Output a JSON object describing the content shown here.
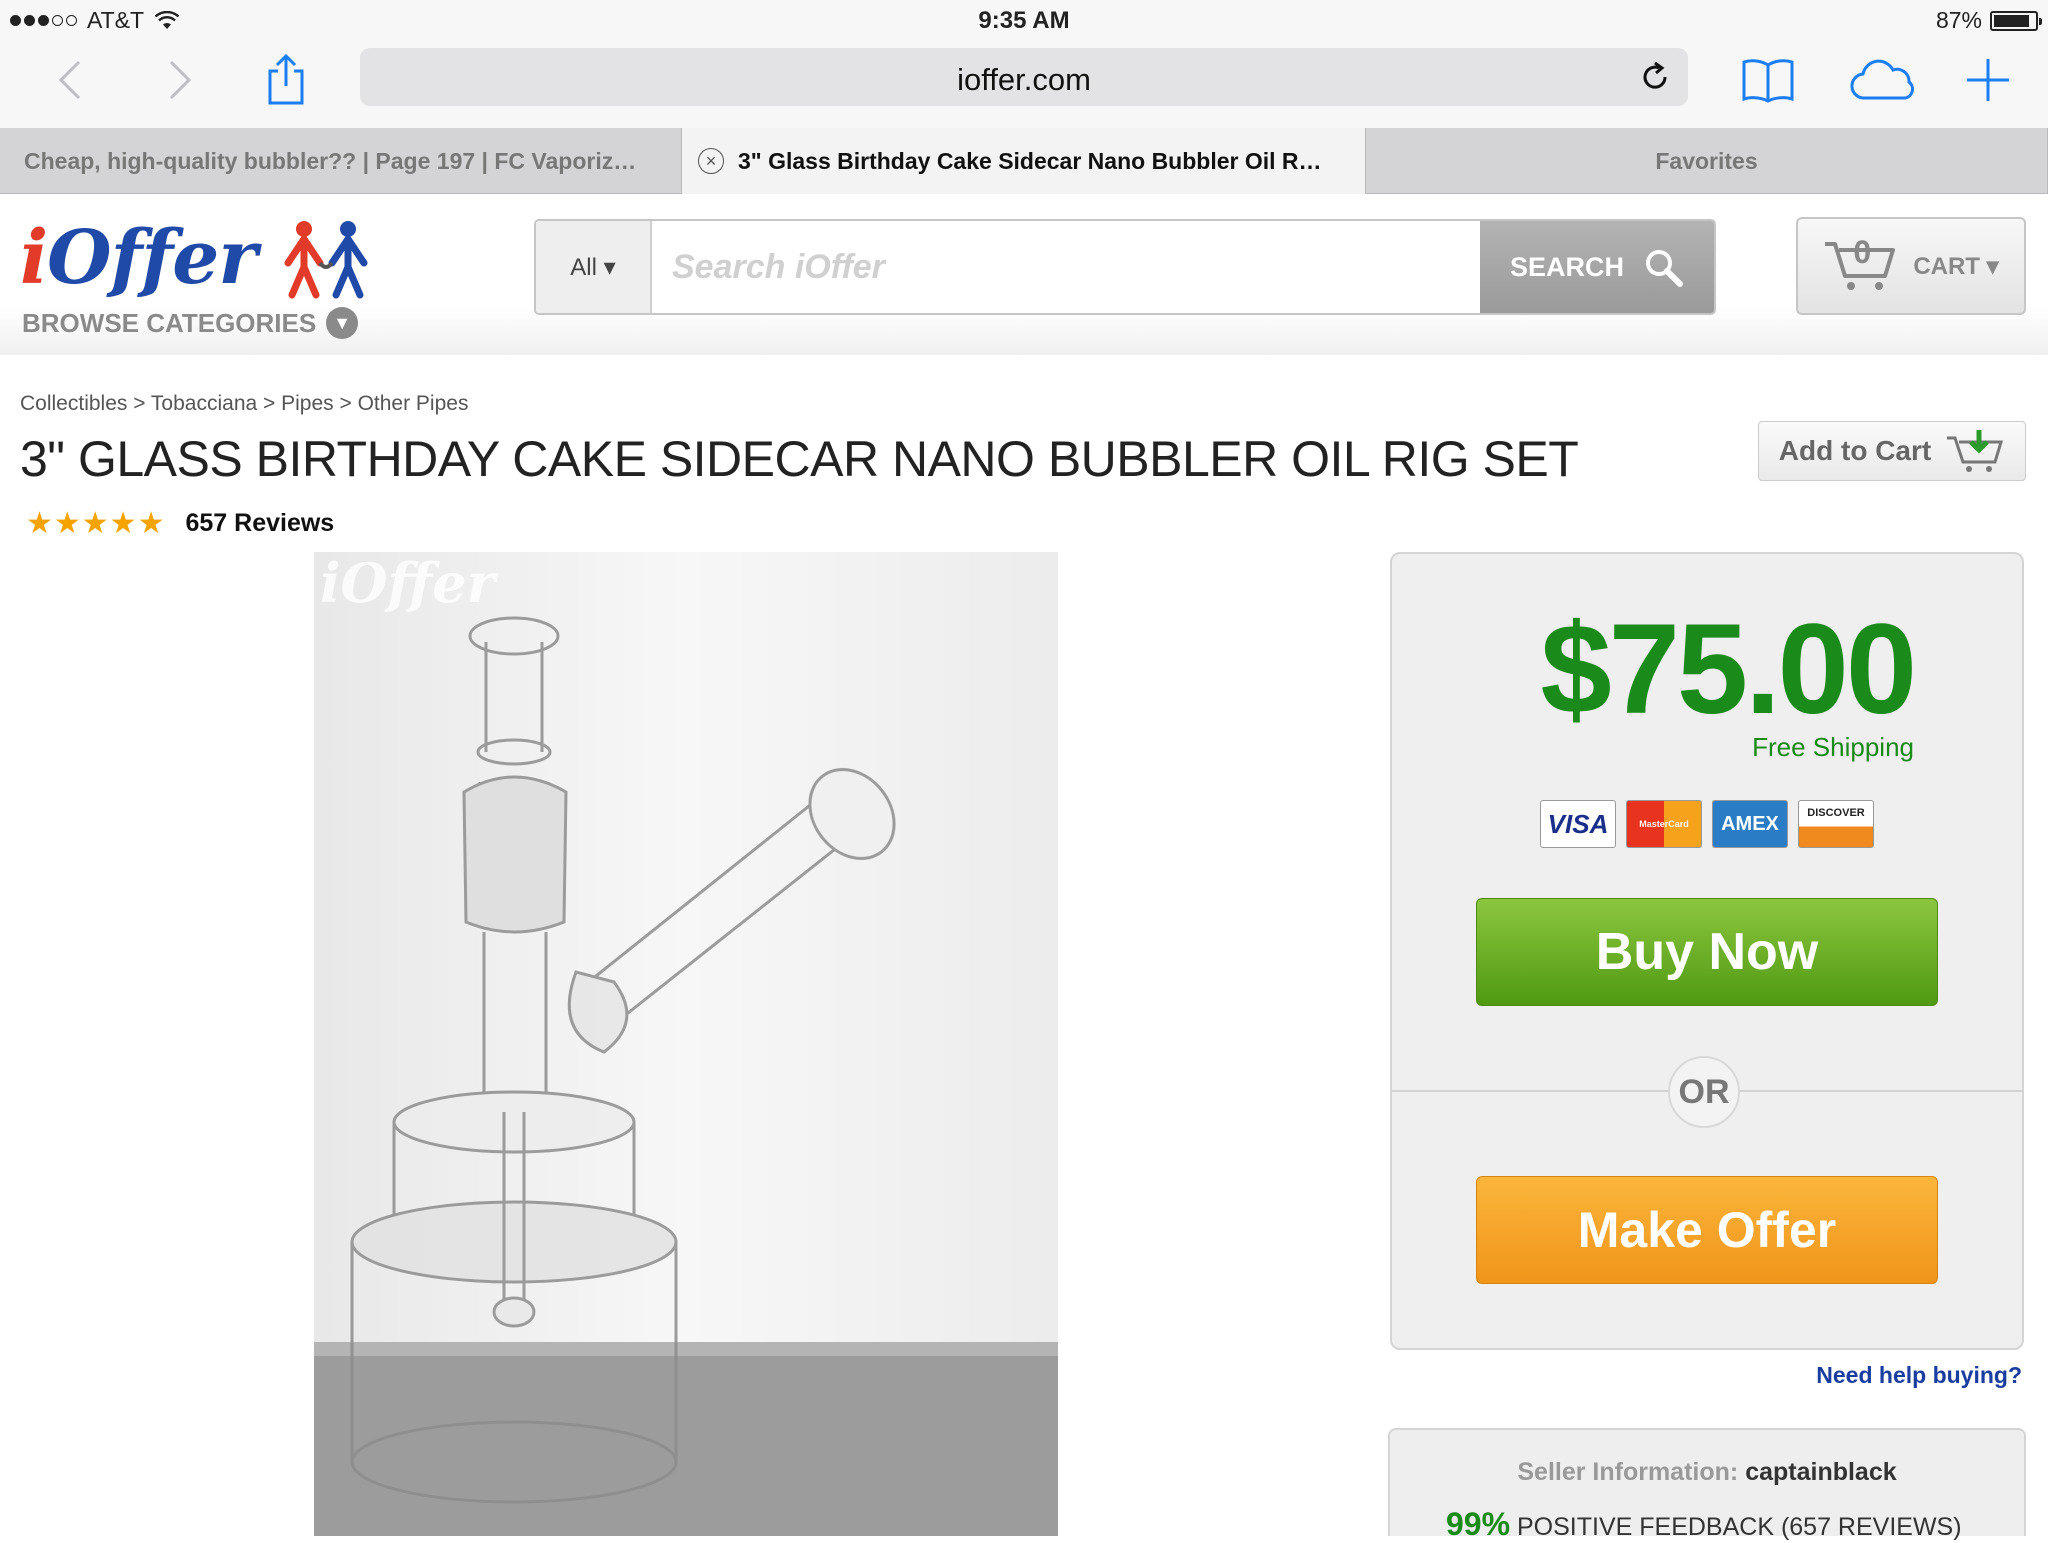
{
  "status_bar": {
    "carrier": "AT&T",
    "time": "9:35 AM",
    "battery": "87%",
    "battery_level": 0.87,
    "signal_bars_filled": 3,
    "signal_bars_total": 5
  },
  "toolbar": {
    "url": "ioffer.com",
    "icons": [
      "back-icon",
      "forward-icon",
      "share-icon",
      "reload-icon",
      "bookmarks-icon",
      "icloud-tabs-icon",
      "new-tab-icon"
    ]
  },
  "tabs": [
    {
      "label": "Cheap, high-quality bubbler?? | Page 197 | FC Vaporiz…",
      "active": false
    },
    {
      "label": "3\" Glass Birthday Cake Sidecar Nano Bubbler Oil R…",
      "active": true
    },
    {
      "label": "Favorites",
      "active": false
    }
  ],
  "header": {
    "logo_text_red": "i",
    "logo_text_blue": "Offer",
    "browse_categories": "BROWSE CATEGORIES",
    "search_scope": "All ▾",
    "search_placeholder": "Search iOffer",
    "search_button": "SEARCH",
    "cart_count": "0",
    "cart_label": "CART ▾"
  },
  "product": {
    "breadcrumb": "Collectibles > Tobacciana > Pipes > Other Pipes",
    "title": "3\" GLASS BIRTHDAY CAKE SIDECAR NANO BUBBLER OIL RIG SET",
    "add_to_cart": "Add to Cart",
    "stars": "★★★★★",
    "rating": 5,
    "reviews": "657 Reviews",
    "watermark": "iOffer"
  },
  "purchase": {
    "price": "$75.00",
    "shipping": "Free Shipping",
    "cards": [
      "VISA",
      "MasterCard",
      "AMEX",
      "DISCOVER"
    ],
    "buy_now": "Buy Now",
    "or": "OR",
    "make_offer": "Make Offer",
    "need_help": "Need help buying?"
  },
  "seller": {
    "label": "Seller Information:",
    "name": "captainblack",
    "feedback_pct": "99%",
    "feedback_text": "POSITIVE FEEDBACK (657 REVIEWS)"
  },
  "colors": {
    "price_green": "#1a8a1a",
    "buy_green": "#6fb22a",
    "offer_orange": "#f5a623",
    "link_blue": "#1a3da0",
    "ios_blue": "#1a7ef2"
  }
}
